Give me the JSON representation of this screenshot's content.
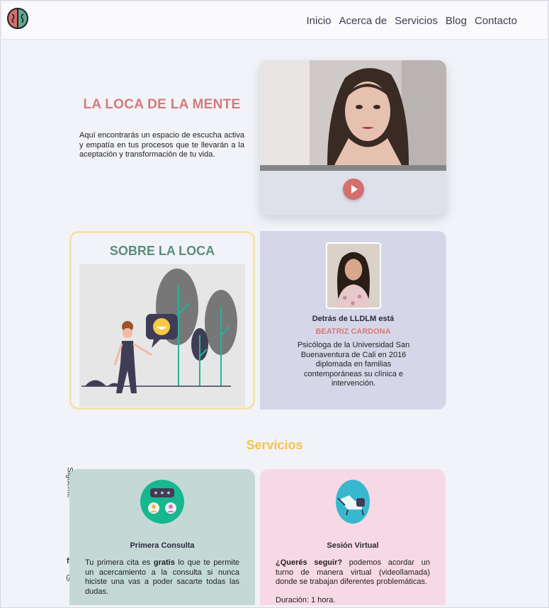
{
  "nav": {
    "items": [
      "Inicio",
      "Acerca de",
      "Servicios",
      "Blog",
      "Contacto"
    ]
  },
  "hero": {
    "title": "LA LOCA DE LA MENTE",
    "text": "Aquí encontrarás un espacio de escucha activa y empatía en tus procesos que te llevarán a la aceptación y transformación de tu vida."
  },
  "about": {
    "title": "SOBRE LA LOCA",
    "pre": "Detrás de LLDLM está",
    "name": "BEATRIZ CARDONA",
    "text": "Psicóloga de la Universidad San Buenaventura de Cali en 2016 diplomada en familias contemporáneas su clínica e intervención."
  },
  "services": {
    "title": "Servicios",
    "cards": [
      {
        "title": "Primera Consulta",
        "text_before": "Tu primera cita es ",
        "text_bold": "gratis",
        "text_after": " lo que te permite un acercamiento a la consulta si nunca hiciste una vas a poder sacarte todas las dudas."
      },
      {
        "title": "Sesión Virtual",
        "text_bold": "¿Querés seguir?",
        "text_after": " podemos acordar un turno de manera virtual (videollamada) donde se trabajan diferentes problemáticas.",
        "extra": "Duración: 1 hora."
      }
    ]
  },
  "follow": {
    "label": "Sigueme"
  },
  "colors": {
    "accent_red": "#d27b7b",
    "accent_green": "#5a8e7a",
    "accent_yellow": "#f5c54a"
  }
}
